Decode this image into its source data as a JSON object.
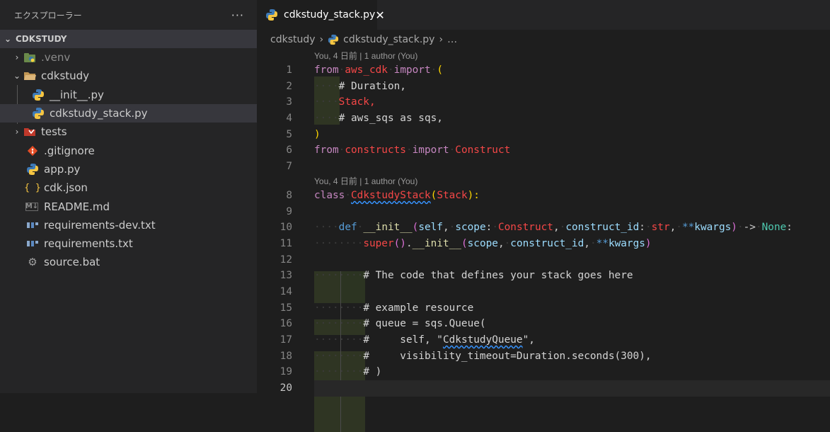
{
  "sidebar": {
    "header_title": "エクスプローラー",
    "more_label": "···",
    "section_title": "CDKSTUDY",
    "items": [
      {
        "label": ".venv",
        "icon": "python-env-folder-icon",
        "twisty": "›",
        "dim": true
      },
      {
        "label": "cdkstudy",
        "icon": "folder-open-icon",
        "twisty": "⌄"
      },
      {
        "label": "__init__.py",
        "icon": "python-file-icon"
      },
      {
        "label": "cdkstudy_stack.py",
        "icon": "python-file-icon"
      },
      {
        "label": "tests",
        "icon": "test-folder-icon",
        "twisty": "›"
      },
      {
        "label": ".gitignore",
        "icon": "git-icon"
      },
      {
        "label": "app.py",
        "icon": "python-file-icon"
      },
      {
        "label": "cdk.json",
        "icon": "json-icon",
        "glyph": "{ }"
      },
      {
        "label": "README.md",
        "icon": "markdown-icon",
        "glyph": "M↓"
      },
      {
        "label": "requirements-dev.txt",
        "icon": "requirements-icon"
      },
      {
        "label": "requirements.txt",
        "icon": "requirements-icon"
      },
      {
        "label": "source.bat",
        "icon": "gear-icon",
        "glyph": "⚙"
      }
    ]
  },
  "editor": {
    "tab_label": "cdkstudy_stack.py",
    "tab_close": "✕",
    "breadcrumb": {
      "folder": "cdkstudy",
      "file": "cdkstudy_stack.py",
      "more": "…"
    },
    "codelens_1": "You, 4 日前 | 1 author (You)",
    "codelens_2": "You, 4 日前 | 1 author (You)",
    "line_numbers": [
      "1",
      "2",
      "3",
      "4",
      "5",
      "6",
      "7",
      "8",
      "9",
      "10",
      "11",
      "12",
      "13",
      "14",
      "15",
      "16",
      "17",
      "18",
      "19",
      "20"
    ],
    "lines": {
      "l1": {
        "from": "from",
        "mod": "aws_cdk",
        "import": "import",
        "paren": "("
      },
      "l2": "# Duration,",
      "l3": "Stack,",
      "l4": "# aws_sqs as sqs,",
      "l5": ")",
      "l6": {
        "from": "from",
        "mod": "constructs",
        "import": "import",
        "cls": "Construct"
      },
      "l8": {
        "class": "class",
        "name": "CdkstudyStack",
        "open": "(",
        "base": "Stack",
        "close": "):"
      },
      "l10": {
        "def": "def",
        "fn": "__init__",
        "open": "(",
        "self": "self",
        "c1": ",",
        "scope": "scope",
        "colon1": ":",
        "construct": "Construct",
        "c2": ",",
        "cid": "construct_id",
        "colon2": ":",
        "str": "str",
        "c3": ",",
        "stars": "**",
        "kwargs": "kwargs",
        "close": ")",
        "arrow": "->",
        "none": "None",
        "colon3": ":"
      },
      "l11": {
        "super": "super",
        "p1": "()",
        "dot": ".",
        "init": "__init__",
        "open": "(",
        "scope": "scope",
        "c1": ",",
        "cid": "construct_id",
        "c2": ",",
        "stars": "**",
        "kwargs": "kwargs",
        "close": ")"
      },
      "l13": "# The code that defines your stack goes here",
      "l15": "# example resource",
      "l16": "# queue = sqs.Queue(",
      "l17a": "#     self, \"",
      "l17b": "CdkstudyQueue",
      "l17c": "\",",
      "l18": "#     visibility_timeout=Duration.seconds(300),",
      "l19": "# )"
    }
  }
}
